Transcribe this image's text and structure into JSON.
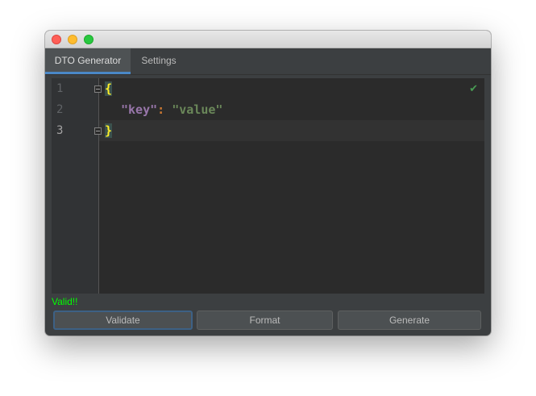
{
  "tabs": [
    {
      "label": "DTO Generator",
      "active": true
    },
    {
      "label": "Settings",
      "active": false
    }
  ],
  "editor": {
    "line_numbers": [
      "1",
      "2",
      "3"
    ],
    "current_line": 3,
    "lines": {
      "open_brace": "{",
      "key": "\"key\"",
      "colon": ":",
      "value": "\"value\"",
      "close_brace": "}"
    },
    "status_icon": "check-icon"
  },
  "status": {
    "text": "Valid!!",
    "color": "#00ff00"
  },
  "buttons": {
    "validate": "Validate",
    "format": "Format",
    "generate": "Generate"
  },
  "colors": {
    "window_bg": "#3c3f41",
    "editor_bg": "#2b2b2b",
    "active_tab_underline": "#4a88c7",
    "json_key": "#9876aa",
    "json_value": "#6a8759",
    "brace_highlight": "#ffef28"
  }
}
